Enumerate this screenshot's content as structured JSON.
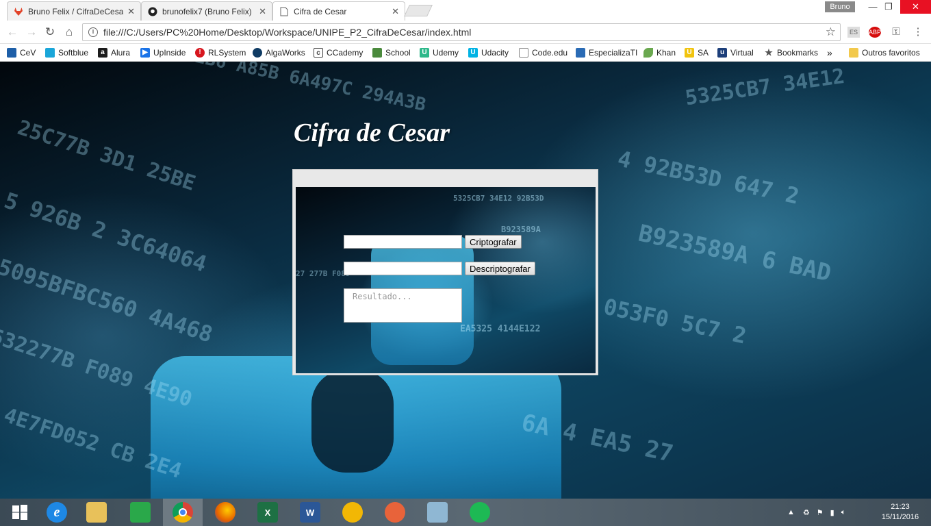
{
  "browser": {
    "tabs": [
      {
        "title": "Bruno Felix / CifraDeCesa",
        "icon": "gitlab-icon"
      },
      {
        "title": "brunofelix7 (Bruno Felix)",
        "icon": "github-icon"
      },
      {
        "title": "Cifra de Cesar",
        "icon": "page-icon",
        "active": true
      }
    ],
    "profile_name": "Bruno",
    "url": "file:///C:/Users/PC%20Home/Desktop/Workspace/UNIPE_P2_CifraDeCesar/index.html",
    "extensions": [
      "ES",
      "ABP"
    ],
    "bookmarks": [
      {
        "label": "CeV",
        "color": "#1e5fa8"
      },
      {
        "label": "Softblue",
        "color": "#1aa6d9"
      },
      {
        "label": "Alura",
        "color": "#1c1c1c"
      },
      {
        "label": "UpInside",
        "color": "#1a73e8"
      },
      {
        "label": "RLSystem",
        "color": "#d7161e"
      },
      {
        "label": "AlgaWorks",
        "color": "#0f3b63"
      },
      {
        "label": "CCademy",
        "color": "#444444"
      },
      {
        "label": "School",
        "color": "#4a8a3c"
      },
      {
        "label": "Udemy",
        "color": "#2eb88a"
      },
      {
        "label": "Udacity",
        "color": "#02b3e4"
      },
      {
        "label": "Code.edu",
        "color": "#888888"
      },
      {
        "label": "EspecializaTI",
        "color": "#2a6bb5"
      },
      {
        "label": "Khan",
        "color": "#6aa84f"
      },
      {
        "label": "SA",
        "color": "#f1c40f"
      },
      {
        "label": "Virtual",
        "color": "#1d3f7a"
      },
      {
        "label": "Bookmarks",
        "color": "#555555"
      }
    ],
    "bookmarks_more": "»",
    "other_bookmarks": "Outros favoritos"
  },
  "page": {
    "title": "Cifra de Cesar",
    "encrypt_input_value": "",
    "encrypt_button": "Criptografar",
    "decrypt_input_value": "",
    "decrypt_button": "Descriptografar",
    "result_placeholder": "Resultado..."
  },
  "taskbar": {
    "apps": [
      {
        "name": "internet-explorer",
        "color": "#1e88e5",
        "glyph": "e"
      },
      {
        "name": "file-explorer",
        "color": "#e8c15a",
        "glyph": ""
      },
      {
        "name": "store",
        "color": "#2aa84a",
        "glyph": ""
      },
      {
        "name": "chrome",
        "color": "#db4437",
        "glyph": "",
        "active": true
      },
      {
        "name": "firefox",
        "color": "#e66000",
        "glyph": ""
      },
      {
        "name": "excel",
        "color": "#1d7044",
        "glyph": "X"
      },
      {
        "name": "word",
        "color": "#2b5797",
        "glyph": "W"
      },
      {
        "name": "tips",
        "color": "#f2b705",
        "glyph": ""
      },
      {
        "name": "tool",
        "color": "#e8633a",
        "glyph": ""
      },
      {
        "name": "notepad",
        "color": "#8fb7d3",
        "glyph": ""
      },
      {
        "name": "spotify",
        "color": "#1db954",
        "glyph": ""
      }
    ],
    "time": "21:23",
    "date": "15/11/2016"
  }
}
